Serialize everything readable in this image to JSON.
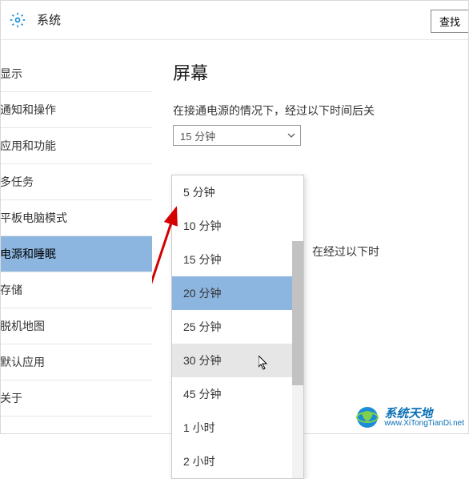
{
  "header": {
    "title": "系统",
    "search_label": "查找"
  },
  "sidebar": {
    "items": [
      {
        "label": "显示"
      },
      {
        "label": "通知和操作"
      },
      {
        "label": "应用和功能"
      },
      {
        "label": "多任务"
      },
      {
        "label": "平板电脑模式"
      },
      {
        "label": "电源和睡眠"
      },
      {
        "label": "存储"
      },
      {
        "label": "脱机地图"
      },
      {
        "label": "默认应用"
      },
      {
        "label": "关于"
      }
    ],
    "selected_index": 5
  },
  "main": {
    "section_title": "屏幕",
    "description": "在接通电源的情况下，经过以下时间后关",
    "combo_value": "15 分钟",
    "side_text": "在经过以下时"
  },
  "dropdown": {
    "items": [
      {
        "label": "5 分钟"
      },
      {
        "label": "10 分钟"
      },
      {
        "label": "15 分钟"
      },
      {
        "label": "20 分钟"
      },
      {
        "label": "25 分钟"
      },
      {
        "label": "30 分钟"
      },
      {
        "label": "45 分钟"
      },
      {
        "label": "1 小时"
      },
      {
        "label": "2 小时"
      }
    ],
    "selected_index": 3,
    "hover_index": 5
  },
  "watermark": {
    "title": "系统天地",
    "url": "www.XiTongTianDi.net"
  }
}
